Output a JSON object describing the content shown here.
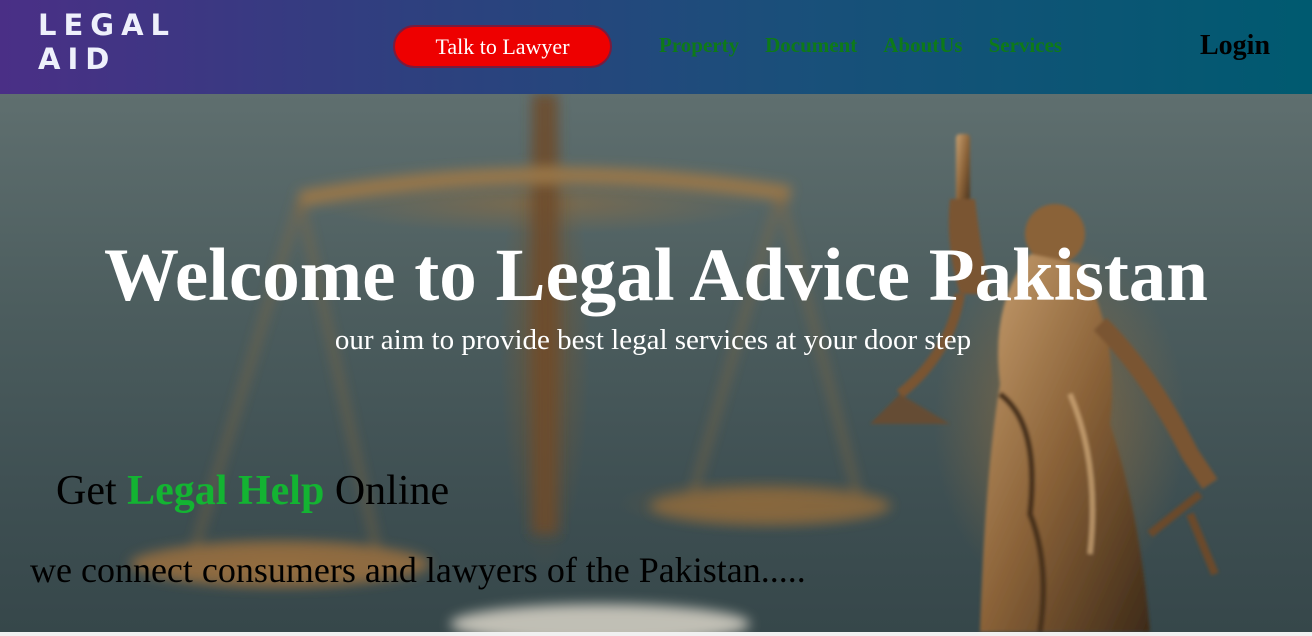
{
  "header": {
    "logo_line1": "LEGAL",
    "logo_line2": "AID",
    "cta_label": "Talk to Lawyer",
    "nav": [
      {
        "label": "Property"
      },
      {
        "label": "Document"
      },
      {
        "label": "AboutUs"
      },
      {
        "label": "Services"
      }
    ],
    "login_label": "Login"
  },
  "hero": {
    "title": "Welcome to Legal Advice Pakistan",
    "subtitle": "our aim to provide best legal services at your door step",
    "tagline_prefix": "Get",
    "tagline_highlight": "Legal Help",
    "tagline_suffix": "Online",
    "description": "we connect consumers and lawyers of the Pakistan....."
  },
  "colors": {
    "header_gradient_start": "#4a2f86",
    "header_gradient_end": "#005a70",
    "cta_background": "#ee0000",
    "nav_link": "#0e7a18",
    "highlight_green": "#13b432"
  }
}
